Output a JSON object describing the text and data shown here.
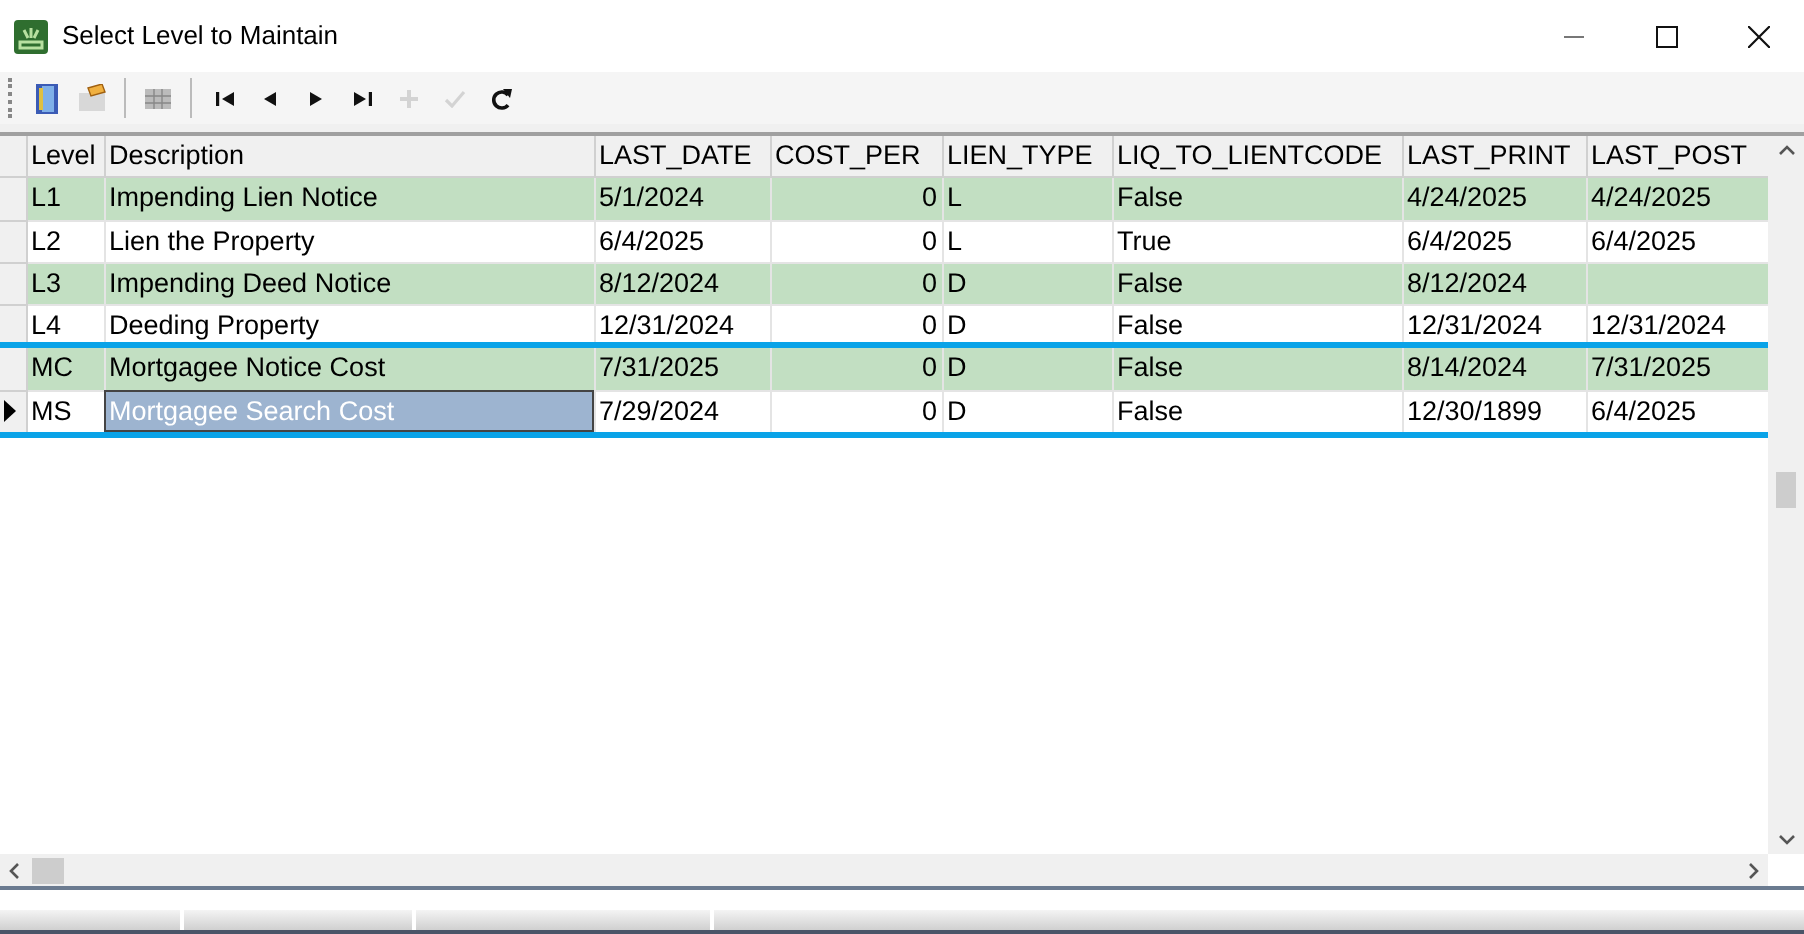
{
  "window": {
    "title": "Select Level to Maintain"
  },
  "toolbar": [
    {
      "kind": "book",
      "disabled": false
    },
    {
      "kind": "edit",
      "disabled": false
    },
    {
      "kind": "grid",
      "disabled": false
    },
    {
      "kind": "first",
      "disabled": false
    },
    {
      "kind": "prior",
      "disabled": false
    },
    {
      "kind": "next",
      "disabled": false
    },
    {
      "kind": "last",
      "disabled": false
    },
    {
      "kind": "insert",
      "disabled": true
    },
    {
      "kind": "post",
      "disabled": true
    },
    {
      "kind": "refresh",
      "disabled": false
    }
  ],
  "table": {
    "columns": [
      {
        "label": "Level",
        "kind": "text"
      },
      {
        "label": "Description",
        "kind": "text"
      },
      {
        "label": "LAST_DATE",
        "kind": "text"
      },
      {
        "label": "COST_PER",
        "kind": "number"
      },
      {
        "label": "LIEN_TYPE",
        "kind": "text"
      },
      {
        "label": "LIQ_TO_LIENTCODE",
        "kind": "text"
      },
      {
        "label": "LAST_PRINT",
        "kind": "text"
      },
      {
        "label": "LAST_POST",
        "kind": "text"
      }
    ],
    "rows": [
      {
        "cells": [
          {
            "text": "L1",
            "selected": false
          },
          {
            "text": "Impending Lien Notice",
            "selected": false
          },
          {
            "text": "5/1/2024",
            "selected": false
          },
          {
            "text": "0",
            "selected": false
          },
          {
            "text": "L",
            "selected": false
          },
          {
            "text": "False",
            "selected": false
          },
          {
            "text": "4/24/2025",
            "selected": false
          },
          {
            "text": "4/24/2025",
            "selected": false
          }
        ],
        "current": false,
        "highlighted": false
      },
      {
        "cells": [
          {
            "text": "L2",
            "selected": false
          },
          {
            "text": "Lien the Property",
            "selected": false
          },
          {
            "text": "6/4/2025",
            "selected": false
          },
          {
            "text": "0",
            "selected": false
          },
          {
            "text": "L",
            "selected": false
          },
          {
            "text": "True",
            "selected": false
          },
          {
            "text": "6/4/2025",
            "selected": false
          },
          {
            "text": "6/4/2025",
            "selected": false
          }
        ],
        "current": false,
        "highlighted": false
      },
      {
        "cells": [
          {
            "text": "L3",
            "selected": false
          },
          {
            "text": "Impending Deed Notice",
            "selected": false
          },
          {
            "text": "8/12/2024",
            "selected": false
          },
          {
            "text": "0",
            "selected": false
          },
          {
            "text": "D",
            "selected": false
          },
          {
            "text": "False",
            "selected": false
          },
          {
            "text": "8/12/2024",
            "selected": false
          },
          {
            "text": "",
            "selected": false
          }
        ],
        "current": false,
        "highlighted": false
      },
      {
        "cells": [
          {
            "text": "L4",
            "selected": false
          },
          {
            "text": "Deeding Property",
            "selected": false
          },
          {
            "text": "12/31/2024",
            "selected": false
          },
          {
            "text": "0",
            "selected": false
          },
          {
            "text": "D",
            "selected": false
          },
          {
            "text": "False",
            "selected": false
          },
          {
            "text": "12/31/2024",
            "selected": false
          },
          {
            "text": "12/31/2024",
            "selected": false
          }
        ],
        "current": false,
        "highlighted": false
      },
      {
        "cells": [
          {
            "text": "MC",
            "selected": false
          },
          {
            "text": "Mortgagee Notice Cost",
            "selected": false
          },
          {
            "text": "7/31/2025",
            "selected": false
          },
          {
            "text": "0",
            "selected": false
          },
          {
            "text": "D",
            "selected": false
          },
          {
            "text": "False",
            "selected": false
          },
          {
            "text": "8/14/2024",
            "selected": false
          },
          {
            "text": "7/31/2025",
            "selected": false
          }
        ],
        "current": false,
        "highlighted": true
      },
      {
        "cells": [
          {
            "text": "MS",
            "selected": false
          },
          {
            "text": "Mortgagee Search Cost",
            "selected": true
          },
          {
            "text": "7/29/2024",
            "selected": false
          },
          {
            "text": "0",
            "selected": false
          },
          {
            "text": "D",
            "selected": false
          },
          {
            "text": "False",
            "selected": false
          },
          {
            "text": "12/30/1899",
            "selected": false
          },
          {
            "text": "6/4/2025",
            "selected": false
          }
        ],
        "current": true,
        "highlighted": true
      }
    ]
  }
}
